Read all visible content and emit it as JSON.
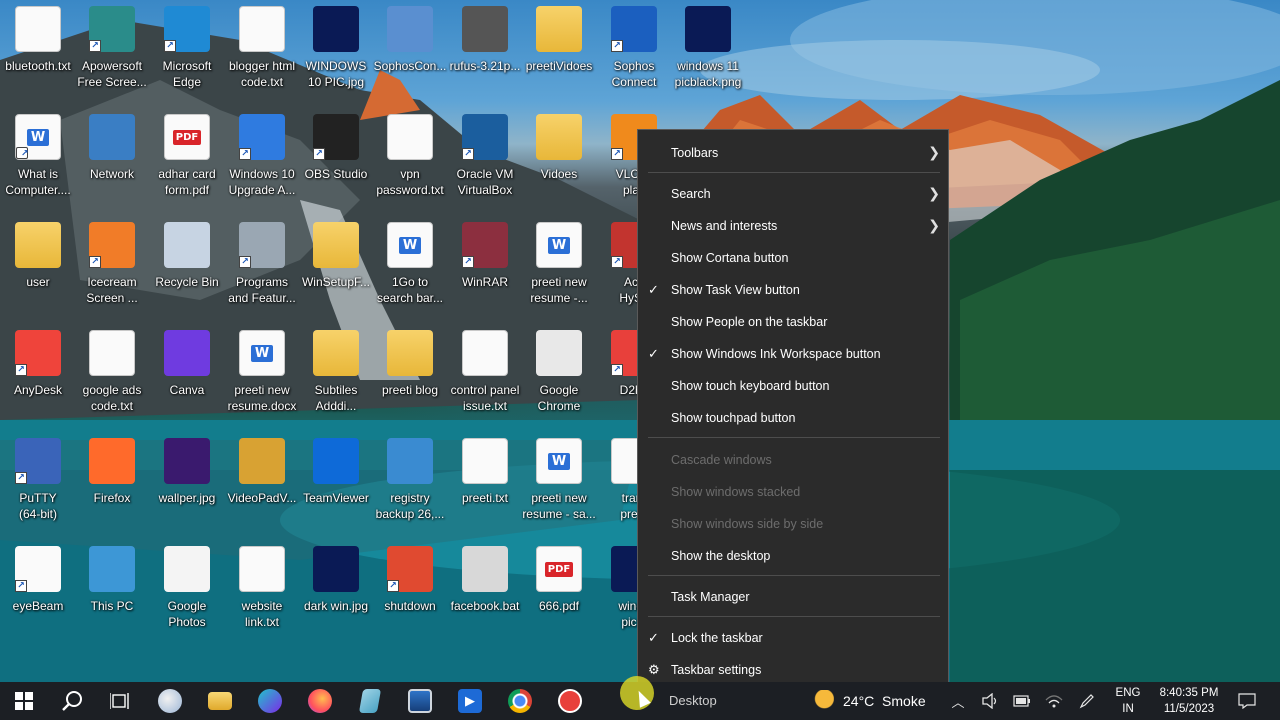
{
  "desktop": {
    "icons": [
      {
        "label": "bluetooth.txt",
        "kind": "doc",
        "shortcut": false
      },
      {
        "label": "Apowersoft\nFree Scree...",
        "kind": "app-rec",
        "shortcut": true
      },
      {
        "label": "Microsoft\nEdge",
        "kind": "edge",
        "shortcut": true
      },
      {
        "label": "blogger html\ncode.txt",
        "kind": "doc",
        "shortcut": false
      },
      {
        "label": "WINDOWS\n10 PIC.jpg",
        "kind": "img",
        "shortcut": false
      },
      {
        "label": "SophosCon...",
        "kind": "installer",
        "shortcut": false
      },
      {
        "label": "rufus-3.21p...",
        "kind": "usb",
        "shortcut": false
      },
      {
        "label": "preetiVidoes",
        "kind": "folder",
        "shortcut": false
      },
      {
        "label": "Sophos\nConnect",
        "kind": "sophos",
        "shortcut": true
      },
      {
        "label": "windows 11\npicblack.png",
        "kind": "img",
        "shortcut": false
      },
      {
        "label": "What is\nComputer....",
        "kind": "word",
        "shortcut": true
      },
      {
        "label": "Network",
        "kind": "network",
        "shortcut": false
      },
      {
        "label": "adhar card\nform.pdf",
        "kind": "pdf",
        "shortcut": false
      },
      {
        "label": "Windows 10\nUpgrade A...",
        "kind": "win-upgrade",
        "shortcut": true
      },
      {
        "label": "OBS Studio",
        "kind": "obs",
        "shortcut": true
      },
      {
        "label": "vpn\npassword.txt",
        "kind": "doc",
        "shortcut": false
      },
      {
        "label": "Oracle VM\nVirtualBox",
        "kind": "vbox",
        "shortcut": true
      },
      {
        "label": "Vidoes",
        "kind": "folder",
        "shortcut": false
      },
      {
        "label": "VLC m\nplay",
        "kind": "vlc",
        "shortcut": true
      },
      {
        "label": "user",
        "kind": "user-folder",
        "shortcut": false
      },
      {
        "label": "Icecream\nScreen ...",
        "kind": "icecream",
        "shortcut": true
      },
      {
        "label": "Recycle Bin",
        "kind": "recycle",
        "shortcut": false
      },
      {
        "label": "Programs\nand Featur...",
        "kind": "programs",
        "shortcut": true
      },
      {
        "label": "WinSetupF...",
        "kind": "folder",
        "shortcut": false
      },
      {
        "label": "1Go to\nsearch bar...",
        "kind": "word",
        "shortcut": false
      },
      {
        "label": "WinRAR",
        "kind": "winrar",
        "shortcut": true
      },
      {
        "label": "preeti new\nresume -...",
        "kind": "word",
        "shortcut": false
      },
      {
        "label": "Acc\nHySe",
        "kind": "shield",
        "shortcut": true
      },
      {
        "label": "AnyDesk",
        "kind": "anydesk",
        "shortcut": true
      },
      {
        "label": "google ads\ncode.txt",
        "kind": "doc",
        "shortcut": false
      },
      {
        "label": "Canva",
        "kind": "canva",
        "shortcut": false
      },
      {
        "label": "preeti new\nresume.docx",
        "kind": "word",
        "shortcut": false
      },
      {
        "label": "Subtiles\nAdddi...",
        "kind": "folder",
        "shortcut": false
      },
      {
        "label": "preeti blog",
        "kind": "folder",
        "shortcut": false
      },
      {
        "label": "control panel\nissue.txt",
        "kind": "doc",
        "shortcut": false
      },
      {
        "label": "Google\nChrome",
        "kind": "chrome",
        "shortcut": false
      },
      {
        "label": "D2h_",
        "kind": "d2h",
        "shortcut": true
      },
      {
        "label": "PuTTY\n(64-bit)",
        "kind": "putty",
        "shortcut": true
      },
      {
        "label": "Firefox",
        "kind": "firefox",
        "shortcut": false
      },
      {
        "label": "wallper.jpg",
        "kind": "img-purple",
        "shortcut": false
      },
      {
        "label": "VideoPadV...",
        "kind": "videopad",
        "shortcut": false
      },
      {
        "label": "TeamViewer",
        "kind": "teamviewer",
        "shortcut": false
      },
      {
        "label": "registry\nbackup 26,...",
        "kind": "registry",
        "shortcut": false
      },
      {
        "label": "preeti.txt",
        "kind": "doc",
        "shortcut": false
      },
      {
        "label": "preeti new\nresume - sa...",
        "kind": "word",
        "shortcut": false
      },
      {
        "label": "tranr\npreet",
        "kind": "doc",
        "shortcut": false
      },
      {
        "label": "eyeBeam",
        "kind": "eyebeam",
        "shortcut": true
      },
      {
        "label": "This PC",
        "kind": "thispc",
        "shortcut": false
      },
      {
        "label": "Google\nPhotos",
        "kind": "gphotos",
        "shortcut": false
      },
      {
        "label": "website\nlink.txt",
        "kind": "doc",
        "shortcut": false
      },
      {
        "label": "dark win.jpg",
        "kind": "img",
        "shortcut": false
      },
      {
        "label": "shutdown",
        "kind": "shutdown",
        "shortcut": true
      },
      {
        "label": "facebook.bat",
        "kind": "bat",
        "shortcut": false
      },
      {
        "label": "666.pdf",
        "kind": "pdf",
        "shortcut": false
      },
      {
        "label": "windo\npic.p",
        "kind": "img",
        "shortcut": false
      }
    ]
  },
  "context_menu": {
    "items": [
      {
        "label": "Toolbars",
        "checked": false,
        "submenu": true,
        "disabled": false,
        "icon": ""
      },
      {
        "label": "Search",
        "checked": false,
        "submenu": true,
        "disabled": false,
        "icon": ""
      },
      {
        "label": "News and interests",
        "checked": false,
        "submenu": true,
        "disabled": false,
        "icon": ""
      },
      {
        "label": "Show Cortana button",
        "checked": false,
        "submenu": false,
        "disabled": false,
        "icon": ""
      },
      {
        "label": "Show Task View button",
        "checked": true,
        "submenu": false,
        "disabled": false,
        "icon": ""
      },
      {
        "label": "Show People on the taskbar",
        "checked": false,
        "submenu": false,
        "disabled": false,
        "icon": ""
      },
      {
        "label": "Show Windows Ink Workspace button",
        "checked": true,
        "submenu": false,
        "disabled": false,
        "icon": ""
      },
      {
        "label": "Show touch keyboard button",
        "checked": false,
        "submenu": false,
        "disabled": false,
        "icon": ""
      },
      {
        "label": "Show touchpad button",
        "checked": false,
        "submenu": false,
        "disabled": false,
        "icon": ""
      },
      {
        "label": "Cascade windows",
        "checked": false,
        "submenu": false,
        "disabled": true,
        "icon": ""
      },
      {
        "label": "Show windows stacked",
        "checked": false,
        "submenu": false,
        "disabled": true,
        "icon": ""
      },
      {
        "label": "Show windows side by side",
        "checked": false,
        "submenu": false,
        "disabled": true,
        "icon": ""
      },
      {
        "label": "Show the desktop",
        "checked": false,
        "submenu": false,
        "disabled": false,
        "icon": ""
      },
      {
        "label": "Task Manager",
        "checked": false,
        "submenu": false,
        "disabled": false,
        "icon": ""
      },
      {
        "label": "Lock the taskbar",
        "checked": true,
        "submenu": false,
        "disabled": false,
        "icon": ""
      },
      {
        "label": "Taskbar settings",
        "checked": false,
        "submenu": false,
        "disabled": false,
        "icon": "gear-icon"
      }
    ]
  },
  "taskbar": {
    "pinned": [
      {
        "name": "start-button",
        "icon": "windows-logo-icon"
      },
      {
        "name": "search-button",
        "icon": "search-icon"
      },
      {
        "name": "task-view-button",
        "icon": "task-view-icon"
      },
      {
        "name": "windows-ink-button",
        "icon": "pen-workspace-icon"
      },
      {
        "name": "file-explorer-button",
        "icon": "folder-icon"
      },
      {
        "name": "canva-button",
        "icon": "canva-icon"
      },
      {
        "name": "firefox-button",
        "icon": "firefox-icon"
      },
      {
        "name": "notepad-button",
        "icon": "notepad-icon"
      },
      {
        "name": "remote-desktop-button",
        "icon": "monitor-icon"
      },
      {
        "name": "media-player-button",
        "icon": "play-icon"
      },
      {
        "name": "chrome-button",
        "icon": "chrome-icon"
      },
      {
        "name": "d2h-button",
        "icon": "d2h-icon"
      }
    ],
    "desktop_label": "Desktop",
    "weather": {
      "text": "24°C  Smoke"
    },
    "language": {
      "line1": "ENG",
      "line2": "IN"
    },
    "clock": {
      "time": "8:40:35 PM",
      "date": "11/5/2023"
    },
    "tray_icons": [
      "chevron-up-icon",
      "speaker-icon",
      "battery-icon",
      "wifi-icon",
      "pen-icon"
    ]
  },
  "colors": {
    "menu_bg": "#2b2b2b",
    "menu_text": "#ffffff",
    "menu_disabled": "#6d6d6d",
    "taskbar_bg": "#1c1f24",
    "accent_blue": "#2b6fd6"
  }
}
